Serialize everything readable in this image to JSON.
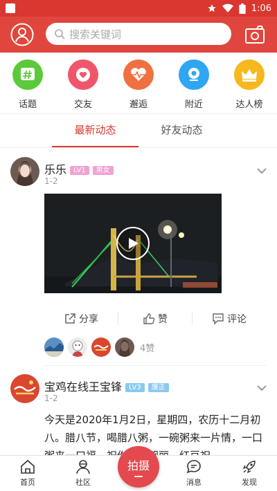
{
  "status": {
    "time": "1:06"
  },
  "header": {
    "search_placeholder": "搜索关键词"
  },
  "categories": [
    {
      "label": "话题",
      "icon": "hashtag-icon",
      "color": "#5cc93a"
    },
    {
      "label": "交友",
      "icon": "heart-icon",
      "color": "#f0566a"
    },
    {
      "label": "邂逅",
      "icon": "heartbeat-icon",
      "color": "#f07140"
    },
    {
      "label": "附近",
      "icon": "location-icon",
      "color": "#2fa6f3"
    },
    {
      "label": "达人榜",
      "icon": "crown-icon",
      "color": "#f6b81d"
    }
  ],
  "tabs": [
    {
      "label": "最新动态",
      "active": true
    },
    {
      "label": "好友动态",
      "active": false
    }
  ],
  "posts": [
    {
      "user": "乐乐",
      "level": "LV1",
      "tag": "男女",
      "date": "1-2",
      "actions": {
        "share": "分享",
        "like": "赞",
        "comment": "评论"
      },
      "likes": "4赞"
    },
    {
      "user": "宝鸡在线王宝锋",
      "level": "LV3",
      "tag": "廉正",
      "date": "1-2",
      "text": "今天是2020年1月2日，星期四，农历十二月初八。腊八节，喝腊八粥，一碗粥来一片情，一口粥来一口福，祝你青春靓丽，红豆祝"
    }
  ],
  "colors": {
    "accent": "#d9372f",
    "header": "#e0463d",
    "level_badge": "#8ac8f0",
    "tag_badge": "#f0a3d2"
  },
  "bottom_nav": {
    "home": "首页",
    "community": "社区",
    "shoot": "拍摄",
    "messages": "消息",
    "discover": "发现"
  }
}
